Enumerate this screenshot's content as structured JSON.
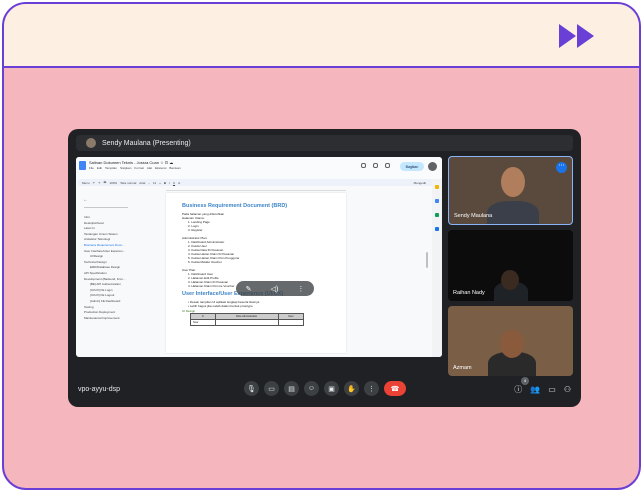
{
  "presenter": {
    "name": "Sendy Maulana (Presenting)"
  },
  "docs": {
    "title": "Salinan Dokumen Teknis - Jossra Cuan ☆ ⊡ ☁",
    "menu": [
      "File",
      "Edit",
      "Tampilan",
      "Sisipkan",
      "Format",
      "Alat",
      "Ekstensi",
      "Bantuan"
    ],
    "share_label": "Bagikan",
    "toolbar": [
      "Menu",
      "↶",
      "↷",
      "🖶",
      "100%",
      "Teks normal",
      "Arial",
      "−",
      "11",
      "+",
      "B",
      "I",
      "U",
      "A",
      "Mengedit"
    ],
    "outline_back": "←",
    "outline": [
      {
        "label": "Intro",
        "level": 0
      },
      {
        "label": "Deskripsi/Goal",
        "level": 0
      },
      {
        "label": "Latar ini",
        "level": 0
      },
      {
        "label": "Tantangan Umum Sistem",
        "level": 0
      },
      {
        "label": "Arsitektur Teknologi",
        "level": 0
      },
      {
        "label": "Business Requirement Docu...",
        "level": 0,
        "active": true
      },
      {
        "label": "User Interface/User Experien...",
        "level": 0
      },
      {
        "label": "UI/Design",
        "level": 1
      },
      {
        "label": "Technical Design",
        "level": 0
      },
      {
        "label": "ERD/Database Design",
        "level": 1
      },
      {
        "label": "API Specification",
        "level": 0
      },
      {
        "label": "Development (Backend, Fron...",
        "level": 0
      },
      {
        "label": "[BE] API Authentication",
        "level": 1
      },
      {
        "label": "[UI/UX] FE Login",
        "level": 1
      },
      {
        "label": "[UI/UX] FE Logout",
        "level": 1
      },
      {
        "label": "[Admin] FE Dashboard",
        "level": 1
      },
      {
        "label": "Testing",
        "level": 0
      },
      {
        "label": "Production Deployment",
        "level": 0
      },
      {
        "label": "Maintenance/Improvement",
        "level": 0
      }
    ],
    "brd_heading": "Business Requirement Document (BRD)",
    "brd_intro": [
      "Pada halaman yang dibutuhkan",
      "Halaman Utama:"
    ],
    "brd_list1": [
      "1.  Landing Page",
      "2.  Login",
      "3.  Register"
    ],
    "admin_label": "Administrator Plan:",
    "admin_list": [
      "1.  Dashboard Administrator",
      "2.  Kelola User",
      "3.  Kelola Data ID Pesanan",
      "4.  Kelola Harian Klaim ID Pesanan",
      "5.  Kelola Harian Klaim Poin Pengguna",
      "6.  Kelola Melalui Voucher"
    ],
    "user_label": "User Plan:",
    "user_list": [
      "1.  Dashboard User",
      "2.  Halaman Edit Profile",
      "3.  Halaman Klaim ID Pesanan",
      "4.  Halaman Klaim Poin ke Voucher"
    ],
    "uiux_heading": "User Interface/User Experience (UI/UX)",
    "uiux_list": [
      "•  Desain tampilan UI aplikasi lengkap beserta flownya",
      "•  Lebih bagus jika sudah dalam bentuk prototype"
    ],
    "ui_design_label": "UI Design",
    "table_header": [
      "#",
      "Role Administrator",
      "User"
    ],
    "table_row": [
      "Now",
      "",
      ""
    ]
  },
  "overlay": {
    "icons": [
      "pin-icon",
      "volume-icon",
      "more-icon"
    ]
  },
  "participants": [
    {
      "name": "Sendy Maulana"
    },
    {
      "name": "Raihan Nady"
    },
    {
      "name": "Azmam"
    }
  ],
  "meeting": {
    "code": "vpo-ayyu-dsp",
    "participant_count": "4"
  },
  "colors": {
    "accent": "#6a3fd6",
    "end_call": "#ea4335",
    "heading": "#3d85c6"
  }
}
